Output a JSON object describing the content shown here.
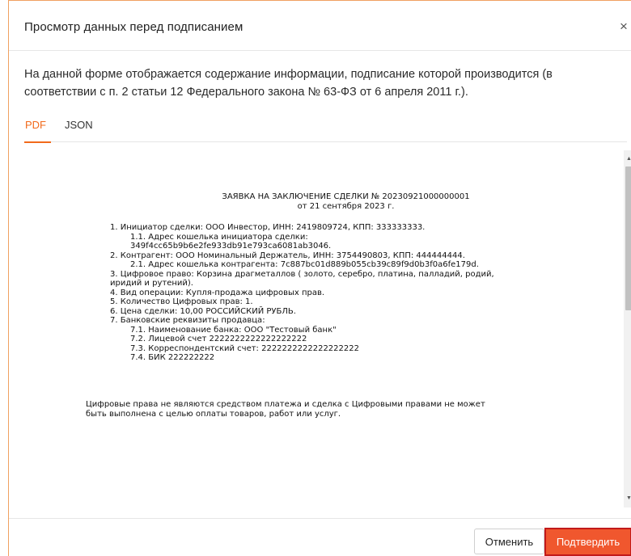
{
  "modal": {
    "title": "Просмотр данных перед подписанием",
    "close_icon": "×"
  },
  "intro": {
    "text": "На данной форме отображается содержание информации, подписание которой производится (в соответствии с п. 2 статьи 12 Федерального закона № 63-ФЗ от 6 апреля 2011 г.)."
  },
  "tabs": [
    {
      "label": "PDF",
      "active": true
    },
    {
      "label": "JSON",
      "active": false
    }
  ],
  "document": {
    "title_line1": "ЗАЯВКА НА ЗАКЛЮЧЕНИЕ СДЕЛКИ № 20230921000000001",
    "title_line2": "от 21 сентября 2023 г.",
    "lines": [
      "1. Инициатор сделки: ООО Инвестор, ИНН: 2419809724, КПП: 333333333.",
      "1.1. Адрес кошелька инициатора сделки:",
      "349f4cc65b9b6e2fe933db91e793ca6081ab3046.",
      "2. Контрагент: ООО Номинальный Держатель, ИНН: 3754490803, КПП: 444444444.",
      "2.1. Адрес кошелька контрагента: 7c887bc01d889b055cb39c89f9d0b3f0a6fe179d.",
      "3. Цифровое право: Корзина драгметаллов ( золото, серебро, платина, палладий, родий,",
      "иридий и рутений).",
      "4. Вид операции: Купля-продажа цифровых прав.",
      "5. Количество Цифровых прав: 1.",
      "6. Цена сделки: 10,00 РОССИЙСКИЙ РУБЛЬ.",
      "7. Банковские реквизиты продавца:",
      "7.1. Наименование банка: ООО \"Тестовый банк\"",
      "7.2. Лицевой счет 2222222222222222222",
      "7.3. Корреспондентский счет: 2222222222222222222",
      "7.4. БИК 222222222"
    ],
    "footnote_line1": "Цифровые права не являются средством платежа и сделка с Цифровыми правами не может",
    "footnote_line2": "быть выполнена с целью оплаты товаров, работ или услуг."
  },
  "scrollbar": {
    "up_arrow": "▲",
    "down_arrow": "▼"
  },
  "footer": {
    "cancel_label": "Отменить",
    "confirm_label": "Подтвердить"
  },
  "colors": {
    "accent": "#f26a1b",
    "confirm_bg": "#f0572e",
    "confirm_border": "#c21a1a"
  }
}
